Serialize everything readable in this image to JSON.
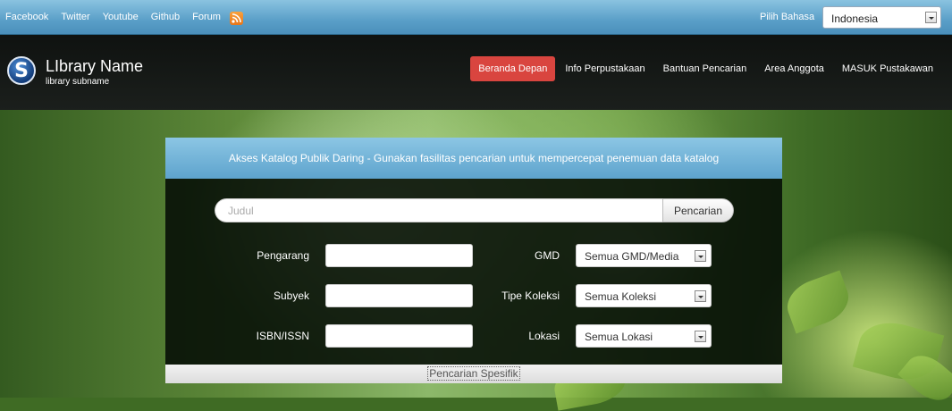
{
  "topbar": {
    "links": [
      "Facebook",
      "Twitter",
      "Youtube",
      "Github",
      "Forum"
    ],
    "rss_icon": "rss-icon",
    "language_label": "Pilih Bahasa",
    "language_selected": "Indonesia"
  },
  "header": {
    "library_name": "LIbrary Name",
    "library_subname": "library subname",
    "logo_letter": "S",
    "nav": [
      "Beranda Depan",
      "Info Perpustakaan",
      "Bantuan Pencarian",
      "Area Anggota",
      "MASUK Pustakawan"
    ],
    "active_color": "#d9453f"
  },
  "panel": {
    "title": "Akses Katalog Publik Daring - Gunakan fasilitas pencarian untuk mempercepat penemuan data katalog",
    "search_placeholder": "Judul",
    "search_button": "Pencarian",
    "fields": {
      "author_label": "Pengarang",
      "subject_label": "Subyek",
      "isbn_label": "ISBN/ISSN",
      "gmd_label": "GMD",
      "gmd_value": "Semua GMD/Media",
      "collection_label": "Tipe Koleksi",
      "collection_value": "Semua Koleksi",
      "location_label": "Lokasi",
      "location_value": "Semua Lokasi"
    },
    "footer_link": "Pencarian Spesifik"
  }
}
